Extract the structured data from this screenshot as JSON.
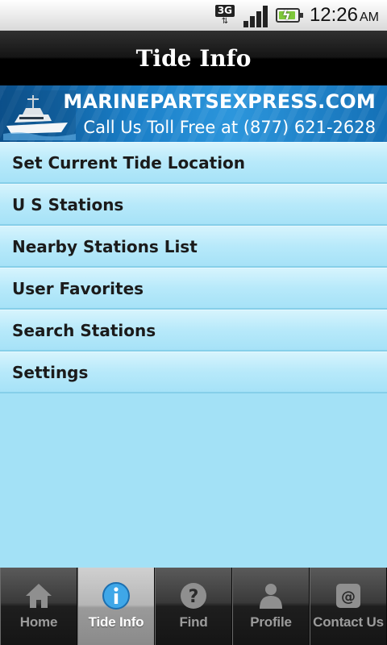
{
  "status_bar": {
    "network": "3G",
    "time": "12:26",
    "ampm": "AM",
    "icons": [
      "3g-data-icon",
      "signal-icon",
      "battery-charging-icon"
    ]
  },
  "header": {
    "title": "Tide Info"
  },
  "banner": {
    "line1": "MARINEPARTSEXPRESS.COM",
    "line2": "Call Us Toll Free at (877) 621-2628"
  },
  "menu": {
    "items": [
      {
        "label": "Set Current Tide Location"
      },
      {
        "label": "U S Stations"
      },
      {
        "label": "Nearby Stations List"
      },
      {
        "label": "User Favorites"
      },
      {
        "label": "Search Stations"
      },
      {
        "label": "Settings"
      }
    ]
  },
  "tabs": [
    {
      "label": "Home",
      "icon": "home-icon",
      "active": false
    },
    {
      "label": "Tide Info",
      "icon": "info-icon",
      "active": true
    },
    {
      "label": "Find",
      "icon": "question-icon",
      "active": false
    },
    {
      "label": "Profile",
      "icon": "person-icon",
      "active": false
    },
    {
      "label": "Contact Us",
      "icon": "at-sign-icon",
      "active": false
    }
  ],
  "colors": {
    "background": "#a3e1f6",
    "active_tab": "#b6b6b6",
    "title_bar": "#000000"
  }
}
